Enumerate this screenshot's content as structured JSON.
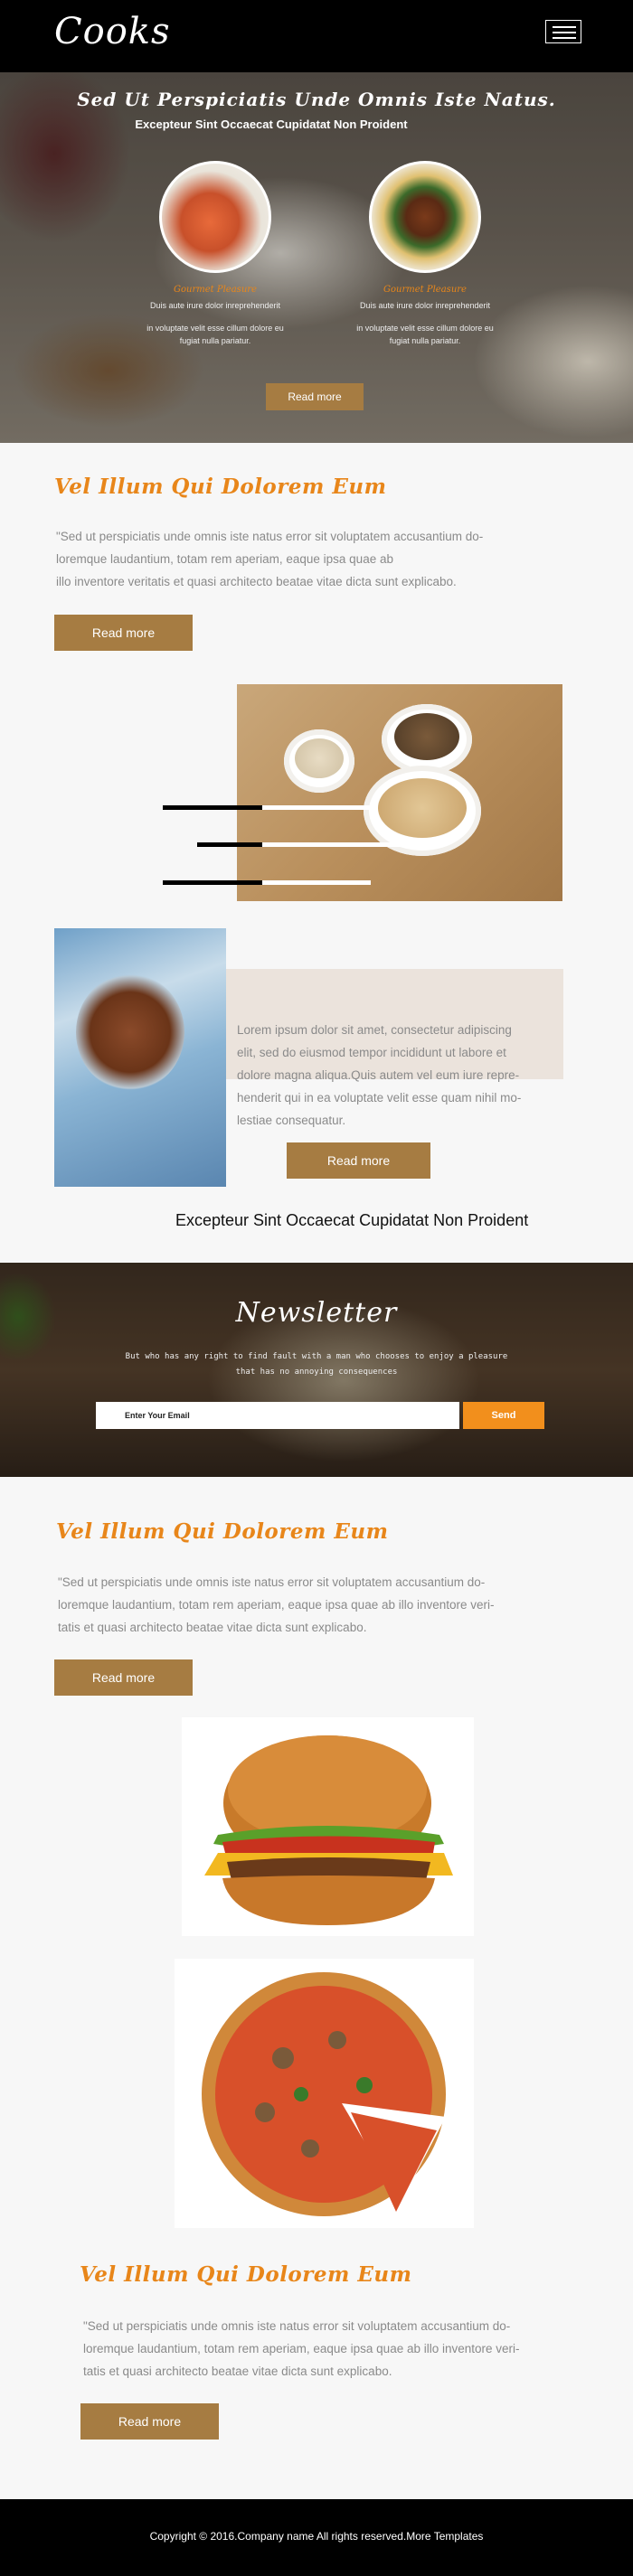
{
  "header": {
    "logo": "Cooks",
    "menu_icon": "hamburger-menu-icon"
  },
  "hero": {
    "title": "Sed Ut Perspiciatis Unde Omnis Iste Natus.",
    "subtitle": "Excepteur Sint Occaecat Cupidatat Non Proident",
    "features": [
      {
        "title": "Gourmet Pleasure",
        "line1": "Duis aute irure dolor inreprehenderit",
        "line2a": "in voluptate velit esse cillum dolore eu",
        "line2b": "fugiat nulla pariatur."
      },
      {
        "title": "Gourmet Pleasure",
        "line1": "Duis aute irure dolor inreprehenderit",
        "line2a": "in voluptate velit esse cillum dolore eu",
        "line2b": "fugiat nulla pariatur."
      }
    ],
    "button": "Read more"
  },
  "about": {
    "title": "Vel Illum Qui Dolorem Eum",
    "line1": "\"Sed ut perspiciatis unde omnis iste natus error sit voluptatem accusantium do-",
    "line2": "loremque laudantium, totam rem aperiam, eaque ipsa quae ab",
    "line3": " illo inventore veritatis et quasi architecto beatae vitae dicta sunt explicabo.",
    "button": "Read more"
  },
  "promo": {
    "line1": "Lorem ipsum dolor sit amet, consectetur adipiscing",
    "line2": "elit, sed do eiusmod tempor incididunt ut labore et",
    "line3": "dolore magna aliqua.Quis autem vel eum iure repre-",
    "line4": "henderit qui in ea voluptate velit esse quam nihil mo-",
    "line5": "lestiae consequatur.",
    "button": "Read more",
    "caption": "Excepteur Sint Occaecat Cupidatat Non Proident"
  },
  "newsletter": {
    "title": "Newsletter",
    "text1": "But who has any right to find fault with a man who chooses to enjoy a pleasure",
    "text2": "that has no annoying consequences",
    "email_placeholder": "Enter Your Email",
    "send": "Send"
  },
  "section2": {
    "title": "Vel Illum Qui Dolorem Eum",
    "line1": "\"Sed ut perspiciatis unde omnis iste natus error sit voluptatem accusantium do-",
    "line2": "loremque laudantium, totam rem aperiam, eaque ipsa quae ab illo inventore veri-",
    "line3": "tatis et quasi architecto beatae vitae dicta sunt explicabo.",
    "button": "Read more"
  },
  "section3": {
    "title": "Vel Illum Qui Dolorem Eum",
    "line1": "\"Sed ut perspiciatis unde omnis iste natus error sit voluptatem accusantium do-",
    "line2": "loremque laudantium, totam rem aperiam, eaque ipsa quae ab illo inventore veri-",
    "line3": "tatis et quasi architecto beatae vitae dicta sunt explicabo.",
    "button": "Read more"
  },
  "footer": {
    "text": "Copyright © 2016.Company name All rights reserved.More Templates"
  },
  "colors": {
    "accent_orange": "#e8861a",
    "button_brown": "#a67c42",
    "send_orange": "#f28f1c",
    "header_black": "#000000"
  }
}
